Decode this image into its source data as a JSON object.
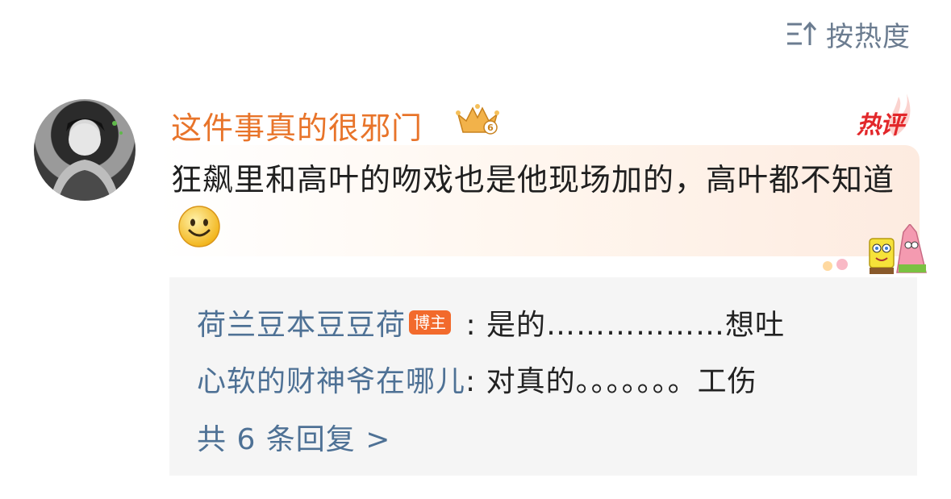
{
  "sort": {
    "label": "按热度",
    "icon": "sort-icon"
  },
  "comment": {
    "username": "这件事真的很邪门",
    "level_badge": "6",
    "hot_tag": "热评",
    "text": "狂飙里和高叶的吻戏也是他现场加的，高叶都不知道",
    "emoji": "smile-emoji",
    "colors": {
      "username": "#e8742a",
      "hot_tag": "#e2272a"
    }
  },
  "replies": {
    "items": [
      {
        "name": "荷兰豆本豆豆荷",
        "badge": "博主",
        "text": " : 是的………………想吐"
      },
      {
        "name": "心软的财神爷在哪儿",
        "badge": "",
        "text": ": 对真的。。。。。。。工伤"
      }
    ],
    "more_label": "共 6 条回复 >",
    "colors": {
      "name": "#4e7195",
      "badge": "#f26a2c"
    }
  }
}
